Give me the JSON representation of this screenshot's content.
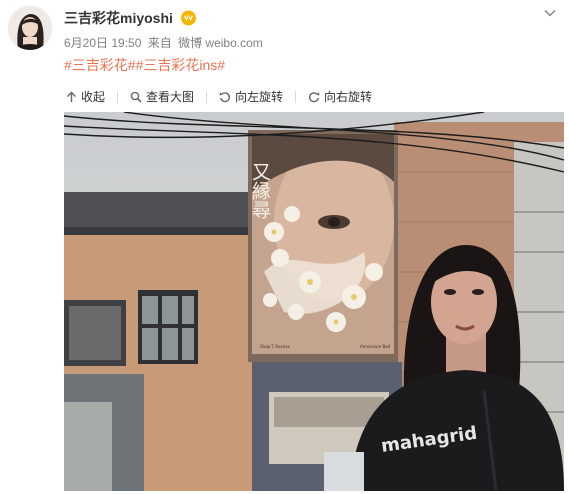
{
  "post": {
    "username": "三吉彩花miyoshi",
    "time": "6月20日 19:50",
    "source_prefix": "来自",
    "source_name": "微博 weibo.com",
    "tags": [
      "#三吉彩花#",
      "#三吉彩花ins#"
    ]
  },
  "icons": {
    "verified": "vip-badge-icon",
    "chevron": "chevron-down-icon",
    "collapse": "arrow-up-icon",
    "view_large": "magnifier-icon",
    "rotate_left": "rotate-left-icon",
    "rotate_right": "rotate-right-icon"
  },
  "toolbar": {
    "collapse": "收起",
    "view_large": "查看大图",
    "rotate_left": "向左旋转",
    "rotate_right": "向右旋转"
  },
  "photo": {
    "poster_text": "又縁尋",
    "shirt_text": "mahagrid",
    "poster_small_left": "Shop 5 Xxxxxx",
    "poster_small_right": "Amnesium Ball"
  },
  "colors": {
    "tag": "#eb7350",
    "username": "#333333",
    "meta": "#808080",
    "badge": "#f7b500"
  }
}
